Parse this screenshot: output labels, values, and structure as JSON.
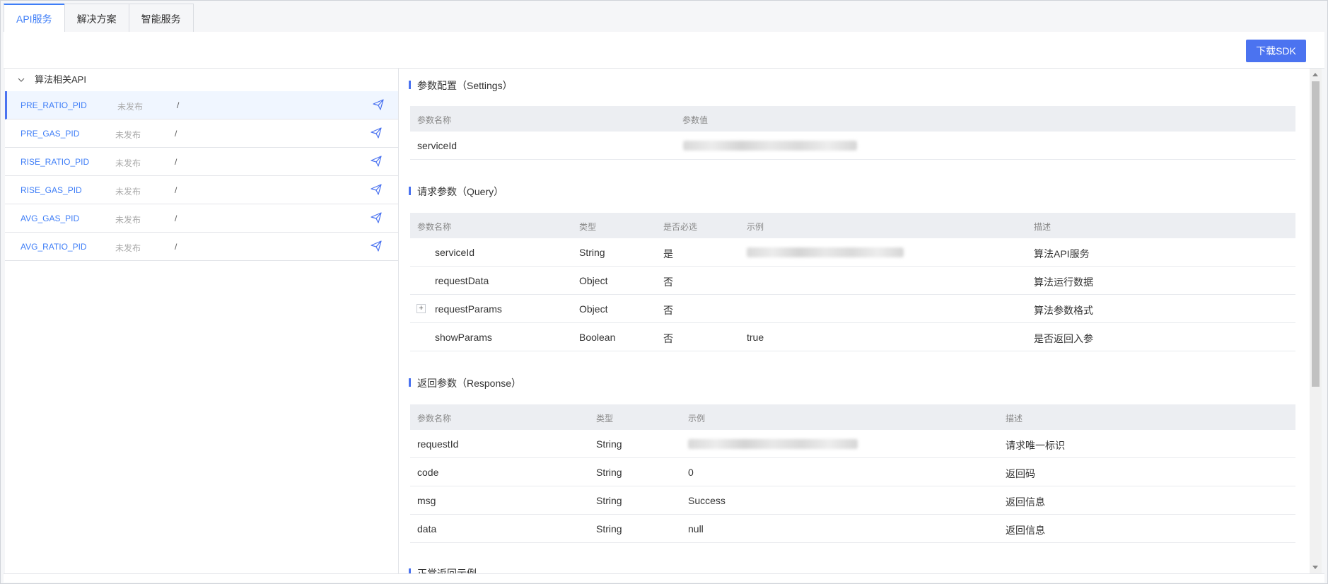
{
  "tabs": [
    {
      "label": "API服务"
    },
    {
      "label": "解决方案"
    },
    {
      "label": "智能服务"
    }
  ],
  "toolbar": {
    "download_sdk_label": "下载SDK"
  },
  "sidebar": {
    "group_label": "算法相关API",
    "items": [
      {
        "name": "PRE_RATIO_PID",
        "status": "未发布",
        "path": "/"
      },
      {
        "name": "PRE_GAS_PID",
        "status": "未发布",
        "path": "/"
      },
      {
        "name": "RISE_RATIO_PID",
        "status": "未发布",
        "path": "/"
      },
      {
        "name": "RISE_GAS_PID",
        "status": "未发布",
        "path": "/"
      },
      {
        "name": "AVG_GAS_PID",
        "status": "未发布",
        "path": "/"
      },
      {
        "name": "AVG_RATIO_PID",
        "status": "未发布",
        "path": "/"
      }
    ]
  },
  "settings": {
    "title": "参数配置（Settings）",
    "headers": [
      "参数名称",
      "参数值"
    ],
    "rows": [
      {
        "name": "serviceId",
        "value": ""
      }
    ]
  },
  "query": {
    "title": "请求参数（Query）",
    "headers": [
      "参数名称",
      "类型",
      "是否必选",
      "示例",
      "描述"
    ],
    "rows": [
      {
        "name": "serviceId",
        "type": "String",
        "required": "是",
        "example": "",
        "desc": "算法API服务"
      },
      {
        "name": "requestData",
        "type": "Object",
        "required": "否",
        "example": "",
        "desc": "算法运行数据"
      },
      {
        "name": "requestParams",
        "type": "Object",
        "required": "否",
        "example": "",
        "desc": "算法参数格式",
        "expand": "+"
      },
      {
        "name": "showParams",
        "type": "Boolean",
        "required": "否",
        "example": "true",
        "desc": "是否返回入参"
      }
    ]
  },
  "response": {
    "title": "返回参数（Response）",
    "headers": [
      "参数名称",
      "类型",
      "示例",
      "描述"
    ],
    "rows": [
      {
        "name": "requestId",
        "type": "String",
        "example": "",
        "desc": "请求唯一标识"
      },
      {
        "name": "code",
        "type": "String",
        "example": "0",
        "desc": "返回码"
      },
      {
        "name": "msg",
        "type": "String",
        "example": "Success",
        "desc": "返回信息"
      },
      {
        "name": "data",
        "type": "String",
        "example": "null",
        "desc": "返回信息"
      }
    ]
  },
  "normal_example": {
    "title": "正常返回示例"
  },
  "colors": {
    "accent": "#4b73f0",
    "link": "#3f7ef7"
  }
}
